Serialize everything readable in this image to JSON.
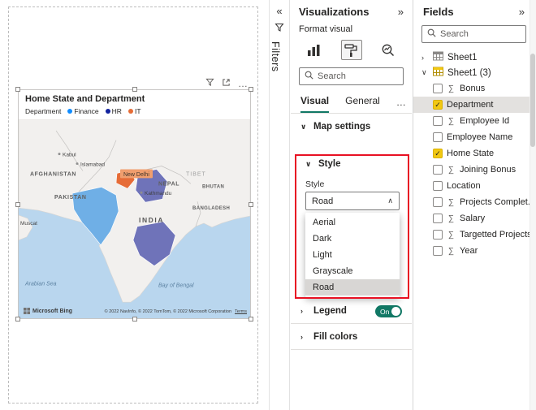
{
  "icons": {
    "collapse_right": "»",
    "collapse_left": "«",
    "more": "…",
    "chevron_down": "∨",
    "chevron_up": "∧",
    "chevron_right": "›",
    "sigma": "∑",
    "check": "✓"
  },
  "colors": {
    "accent": "#117865",
    "highlight_red": "#E81123",
    "check_yellow": "#F2C811",
    "finance": "#118DFF",
    "hr": "#12239E",
    "it": "#E66C37"
  },
  "canvas": {
    "visual": {
      "title": "Home State and Department",
      "legend_title": "Department",
      "legend_items": [
        {
          "label": "Finance",
          "color": "#118DFF"
        },
        {
          "label": "HR",
          "color": "#12239E"
        },
        {
          "label": "IT",
          "color": "#E66C37"
        }
      ],
      "map": {
        "labels": {
          "kabul": "Kabul",
          "islamabad": "Islamabad",
          "afghanistan": "AFGHANISTAN",
          "tibet": "TIBET",
          "pakistan": "PAKISTAN",
          "new_delhi": "New Delhi",
          "nepal": "NEPAL",
          "kathmandu": "Kathmandu",
          "bhutan": "BHUTAN",
          "bangladesh": "BANGLADESH",
          "india": "INDIA",
          "muscat": "Muscat",
          "arabian_sea": "Arabian Sea",
          "bay_of_bengal": "Bay of Bengal"
        },
        "attribution": "© 2022 NavInfo, © 2022 TomTom, © 2022 Microsoft Corporation",
        "terms": "Terms",
        "bing": "Microsoft Bing"
      }
    }
  },
  "filters": {
    "title": "Filters"
  },
  "viz": {
    "title": "Visualizations",
    "mode_label": "Format visual",
    "search_placeholder": "Search",
    "tabs": {
      "visual": "Visual",
      "general": "General"
    },
    "map_settings": "Map settings",
    "style_section": "Style",
    "style_label": "Style",
    "style_value": "Road",
    "options": [
      "Aerial",
      "Dark",
      "Light",
      "Grayscale",
      "Road"
    ],
    "selected_option": "Road",
    "legend_label": "Legend",
    "legend_state": "On",
    "fill_colors": "Fill colors"
  },
  "fields": {
    "title": "Fields",
    "search_placeholder": "Search",
    "tables": [
      {
        "name": "Sheet1",
        "expanded": false
      },
      {
        "name": "Sheet1 (3)",
        "expanded": true
      }
    ],
    "items": [
      {
        "label": "Bonus",
        "numeric": true,
        "checked": false
      },
      {
        "label": "Department",
        "numeric": false,
        "checked": true
      },
      {
        "label": "Employee Id",
        "numeric": true,
        "checked": false
      },
      {
        "label": "Employee Name",
        "numeric": false,
        "checked": false
      },
      {
        "label": "Home State",
        "numeric": false,
        "checked": true
      },
      {
        "label": "Joining Bonus",
        "numeric": true,
        "checked": false
      },
      {
        "label": "Location",
        "numeric": false,
        "checked": false
      },
      {
        "label": "Projects Complet...",
        "numeric": true,
        "checked": false
      },
      {
        "label": "Salary",
        "numeric": true,
        "checked": false
      },
      {
        "label": "Targetted Projects",
        "numeric": true,
        "checked": false
      },
      {
        "label": "Year",
        "numeric": true,
        "checked": false
      }
    ]
  }
}
